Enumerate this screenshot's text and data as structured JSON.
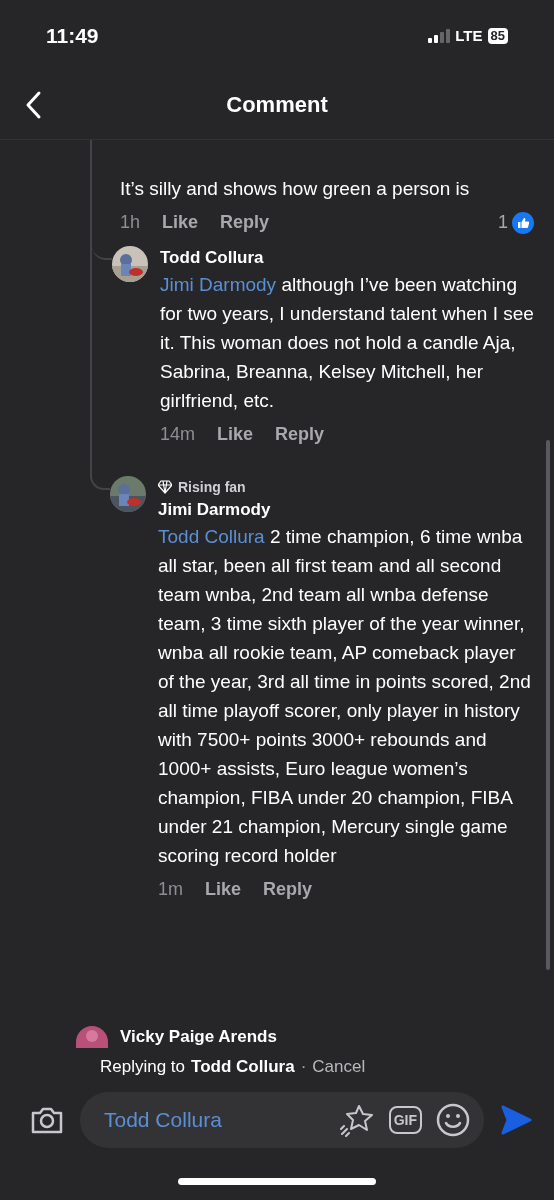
{
  "status_bar": {
    "time": "11:49",
    "network": "LTE",
    "battery": "85"
  },
  "header": {
    "title": "Comment"
  },
  "parent_comment": {
    "text": "It’s silly and shows how green a person is",
    "time": "1h",
    "like": "Like",
    "reply": "Reply",
    "reaction_count": "1"
  },
  "replies": [
    {
      "author": "Todd Collura",
      "mention": "Jimi Darmody",
      "text": "although I’ve been watching for two years, I understand talent when I see it. This woman does not hold a candle Aja, Sabrina, Breanna, Kelsey Mitchell, her girlfriend, etc.",
      "time": "14m",
      "like": "Like",
      "reply": "Reply"
    },
    {
      "badge": "Rising fan",
      "author": "Jimi Darmody",
      "mention": "Todd Collura",
      "text": "2 time champion, 6 time wnba all star, been all first team and all second team wnba, 2nd team all wnba defense team, 3 time sixth player of the year winner, wnba all rookie team, AP comeback player of the year, 3rd all time in points scored, 2nd all time playoff scorer, only player in history with 7500+ points 3000+ rebounds and 1000+ assists, Euro league women’s champion, FIBA under 20 champion, FIBA under 21 champion, Mercury single game scoring record holder",
      "time": "1m",
      "like": "Like",
      "reply": "Reply"
    }
  ],
  "next_comment": {
    "author": "Vicky Paige Arends"
  },
  "reply_bar": {
    "prefix": "Replying to",
    "name": "Todd Collura",
    "separator": "·",
    "cancel": "Cancel"
  },
  "composer": {
    "value": "Todd Collura",
    "gif": "GIF"
  }
}
